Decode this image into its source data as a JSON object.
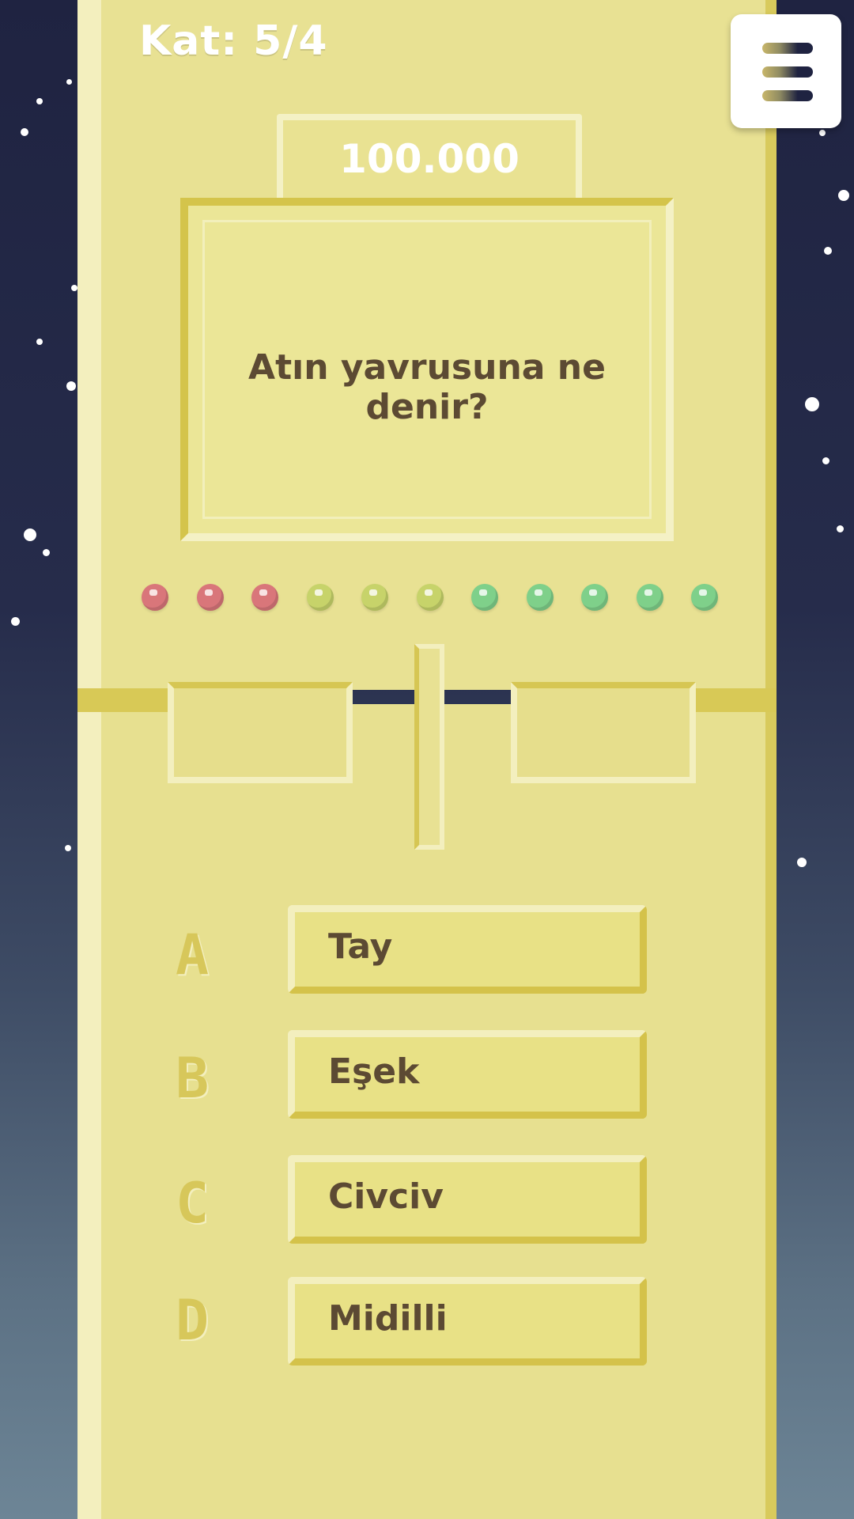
{
  "header": {
    "level": "Kat: 5/4"
  },
  "prize": "100.000",
  "question": "Atın yavrusuna ne denir?",
  "progress_dots": {
    "colors": [
      "#d9767a",
      "#d9767a",
      "#d9767a",
      "#c7d36a",
      "#c7d36a",
      "#c7d36a",
      "#7fd08a",
      "#7fd08a",
      "#7fd08a",
      "#7fd08a",
      "#7fd08a"
    ]
  },
  "answers": [
    {
      "letter": "A",
      "text": "Tay"
    },
    {
      "letter": "B",
      "text": "Eşek"
    },
    {
      "letter": "C",
      "text": "Civciv"
    },
    {
      "letter": "D",
      "text": "Midilli"
    }
  ],
  "menu": {
    "icon": "hamburger-menu-icon"
  }
}
